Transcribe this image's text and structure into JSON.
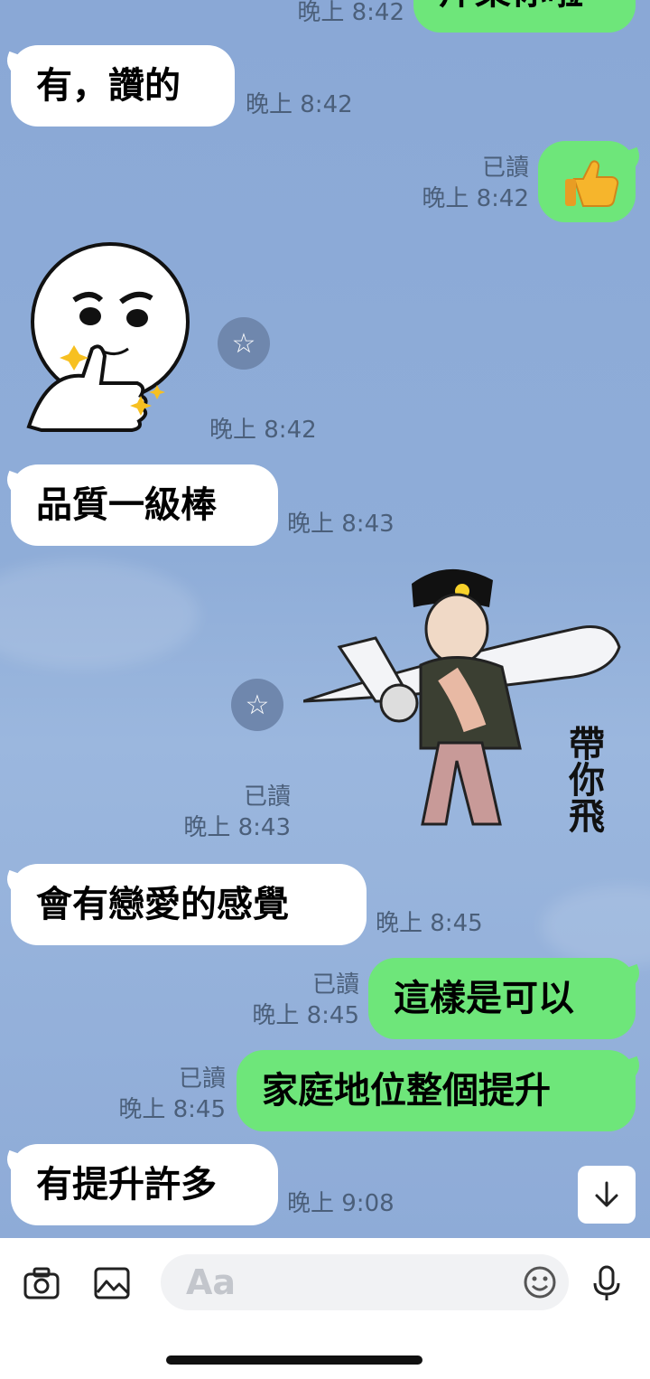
{
  "messages": {
    "top_out": {
      "text": "芹菜你啦",
      "time": "晚上 8:42"
    },
    "m1": {
      "text": "有，讚的",
      "time": "晚上 8:42"
    },
    "m2": {
      "read": "已讀",
      "time": "晚上 8:42"
    },
    "s1": {
      "time": "晚上 8:42"
    },
    "m3": {
      "text": "品質一級棒",
      "time": "晚上 8:43"
    },
    "s2": {
      "read": "已讀",
      "time": "晚上 8:43",
      "caption": "帶你飛"
    },
    "m4": {
      "text": "會有戀愛的感覺",
      "time": "晚上 8:45"
    },
    "m5": {
      "text": "這樣是可以",
      "read": "已讀",
      "time": "晚上 8:45"
    },
    "m6": {
      "text": "家庭地位整個提升",
      "read": "已讀",
      "time": "晚上 8:45"
    },
    "m7": {
      "text": "有提升許多",
      "time": "晚上 9:08"
    }
  },
  "input": {
    "placeholder": "Aa"
  },
  "icons": {
    "camera": "camera-icon",
    "image": "image-icon",
    "emoji": "emoji-icon",
    "mic": "microphone-icon",
    "scroll": "arrow-down-icon",
    "star": "star-icon"
  },
  "colors": {
    "chat_bg": "#8fabd7",
    "outgoing": "#6ee67a",
    "incoming": "#ffffff"
  }
}
